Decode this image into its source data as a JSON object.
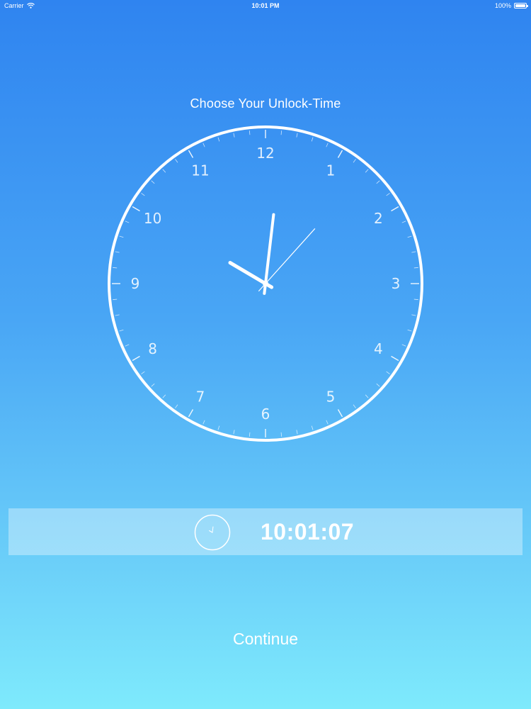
{
  "status_bar": {
    "carrier": "Carrier",
    "time": "10:01 PM",
    "battery_percent": "100%",
    "battery_level": 1.0
  },
  "title": "Choose Your Unlock-Time",
  "clock": {
    "numerals": [
      "12",
      "1",
      "2",
      "3",
      "4",
      "5",
      "6",
      "7",
      "8",
      "9",
      "10",
      "11"
    ],
    "hour": 10,
    "minute": 1,
    "second": 7
  },
  "time_display": {
    "value": "10:01:07"
  },
  "continue_label": "Continue",
  "colors": {
    "gradient_top": "#2f84f0",
    "gradient_bottom": "#7eeafc",
    "foreground": "#ffffff"
  },
  "icons": {
    "wifi": "wifi-icon",
    "battery": "battery-icon",
    "mini_clock": "clock-icon"
  }
}
